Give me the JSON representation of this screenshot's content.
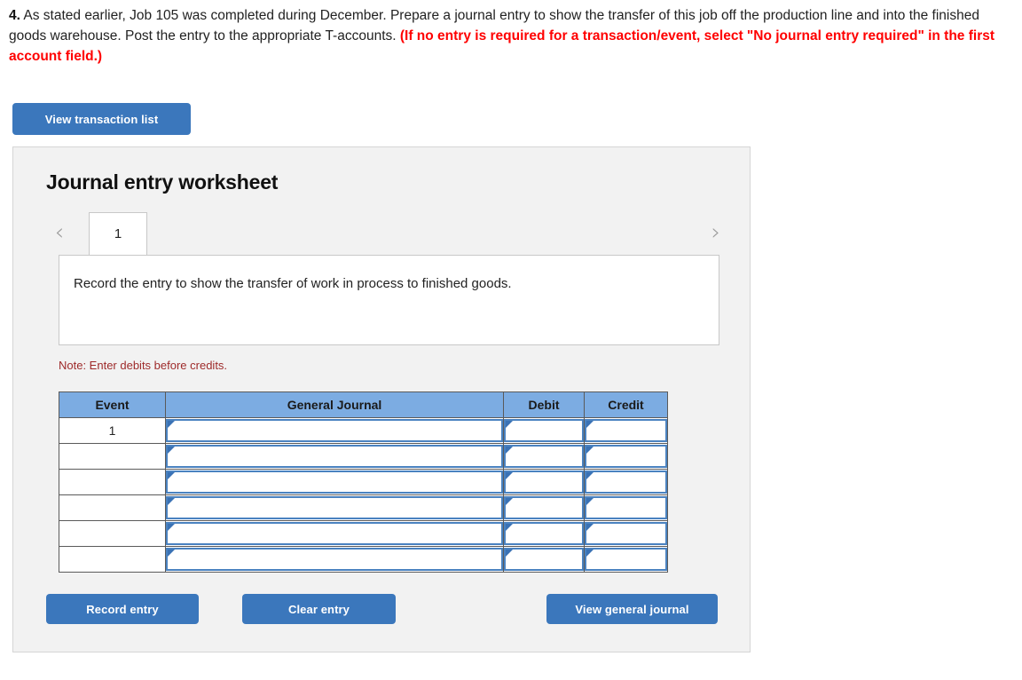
{
  "question": {
    "number": "4.",
    "body": " As stated earlier, Job 105 was completed during December. Prepare a journal entry to show the transfer of this job off the production line and into the finished goods warehouse. Post the entry to the appropriate T-accounts. ",
    "red_note": "(If no entry is required for a transaction/event, select \"No journal entry required\" in the first account field.)",
    "red_color": "#ff0000"
  },
  "toolbar": {
    "view_transaction_list_label": "View transaction list"
  },
  "card": {
    "title": "Journal entry worksheet",
    "tabs": {
      "prev_icon": "chevron-left-icon",
      "next_icon": "chevron-right-icon",
      "items": [
        {
          "label": "1",
          "active": true
        }
      ]
    },
    "instruction": "Record the entry to show the transfer of work in process to finished goods.",
    "note": "Note: Enter debits before credits.",
    "table": {
      "headers": [
        "Event",
        "General Journal",
        "Debit",
        "Credit"
      ],
      "header_bg": "#7cace2",
      "rows": [
        {
          "event": "1",
          "journal": "",
          "debit": "",
          "credit": ""
        },
        {
          "event": "",
          "journal": "",
          "debit": "",
          "credit": ""
        },
        {
          "event": "",
          "journal": "",
          "debit": "",
          "credit": ""
        },
        {
          "event": "",
          "journal": "",
          "debit": "",
          "credit": ""
        },
        {
          "event": "",
          "journal": "",
          "debit": "",
          "credit": ""
        },
        {
          "event": "",
          "journal": "",
          "debit": "",
          "credit": ""
        }
      ]
    },
    "actions": {
      "record_entry_label": "Record entry",
      "clear_entry_label": "Clear entry",
      "view_general_journal_label": "View general journal",
      "button_color": "#3b77bc"
    }
  }
}
